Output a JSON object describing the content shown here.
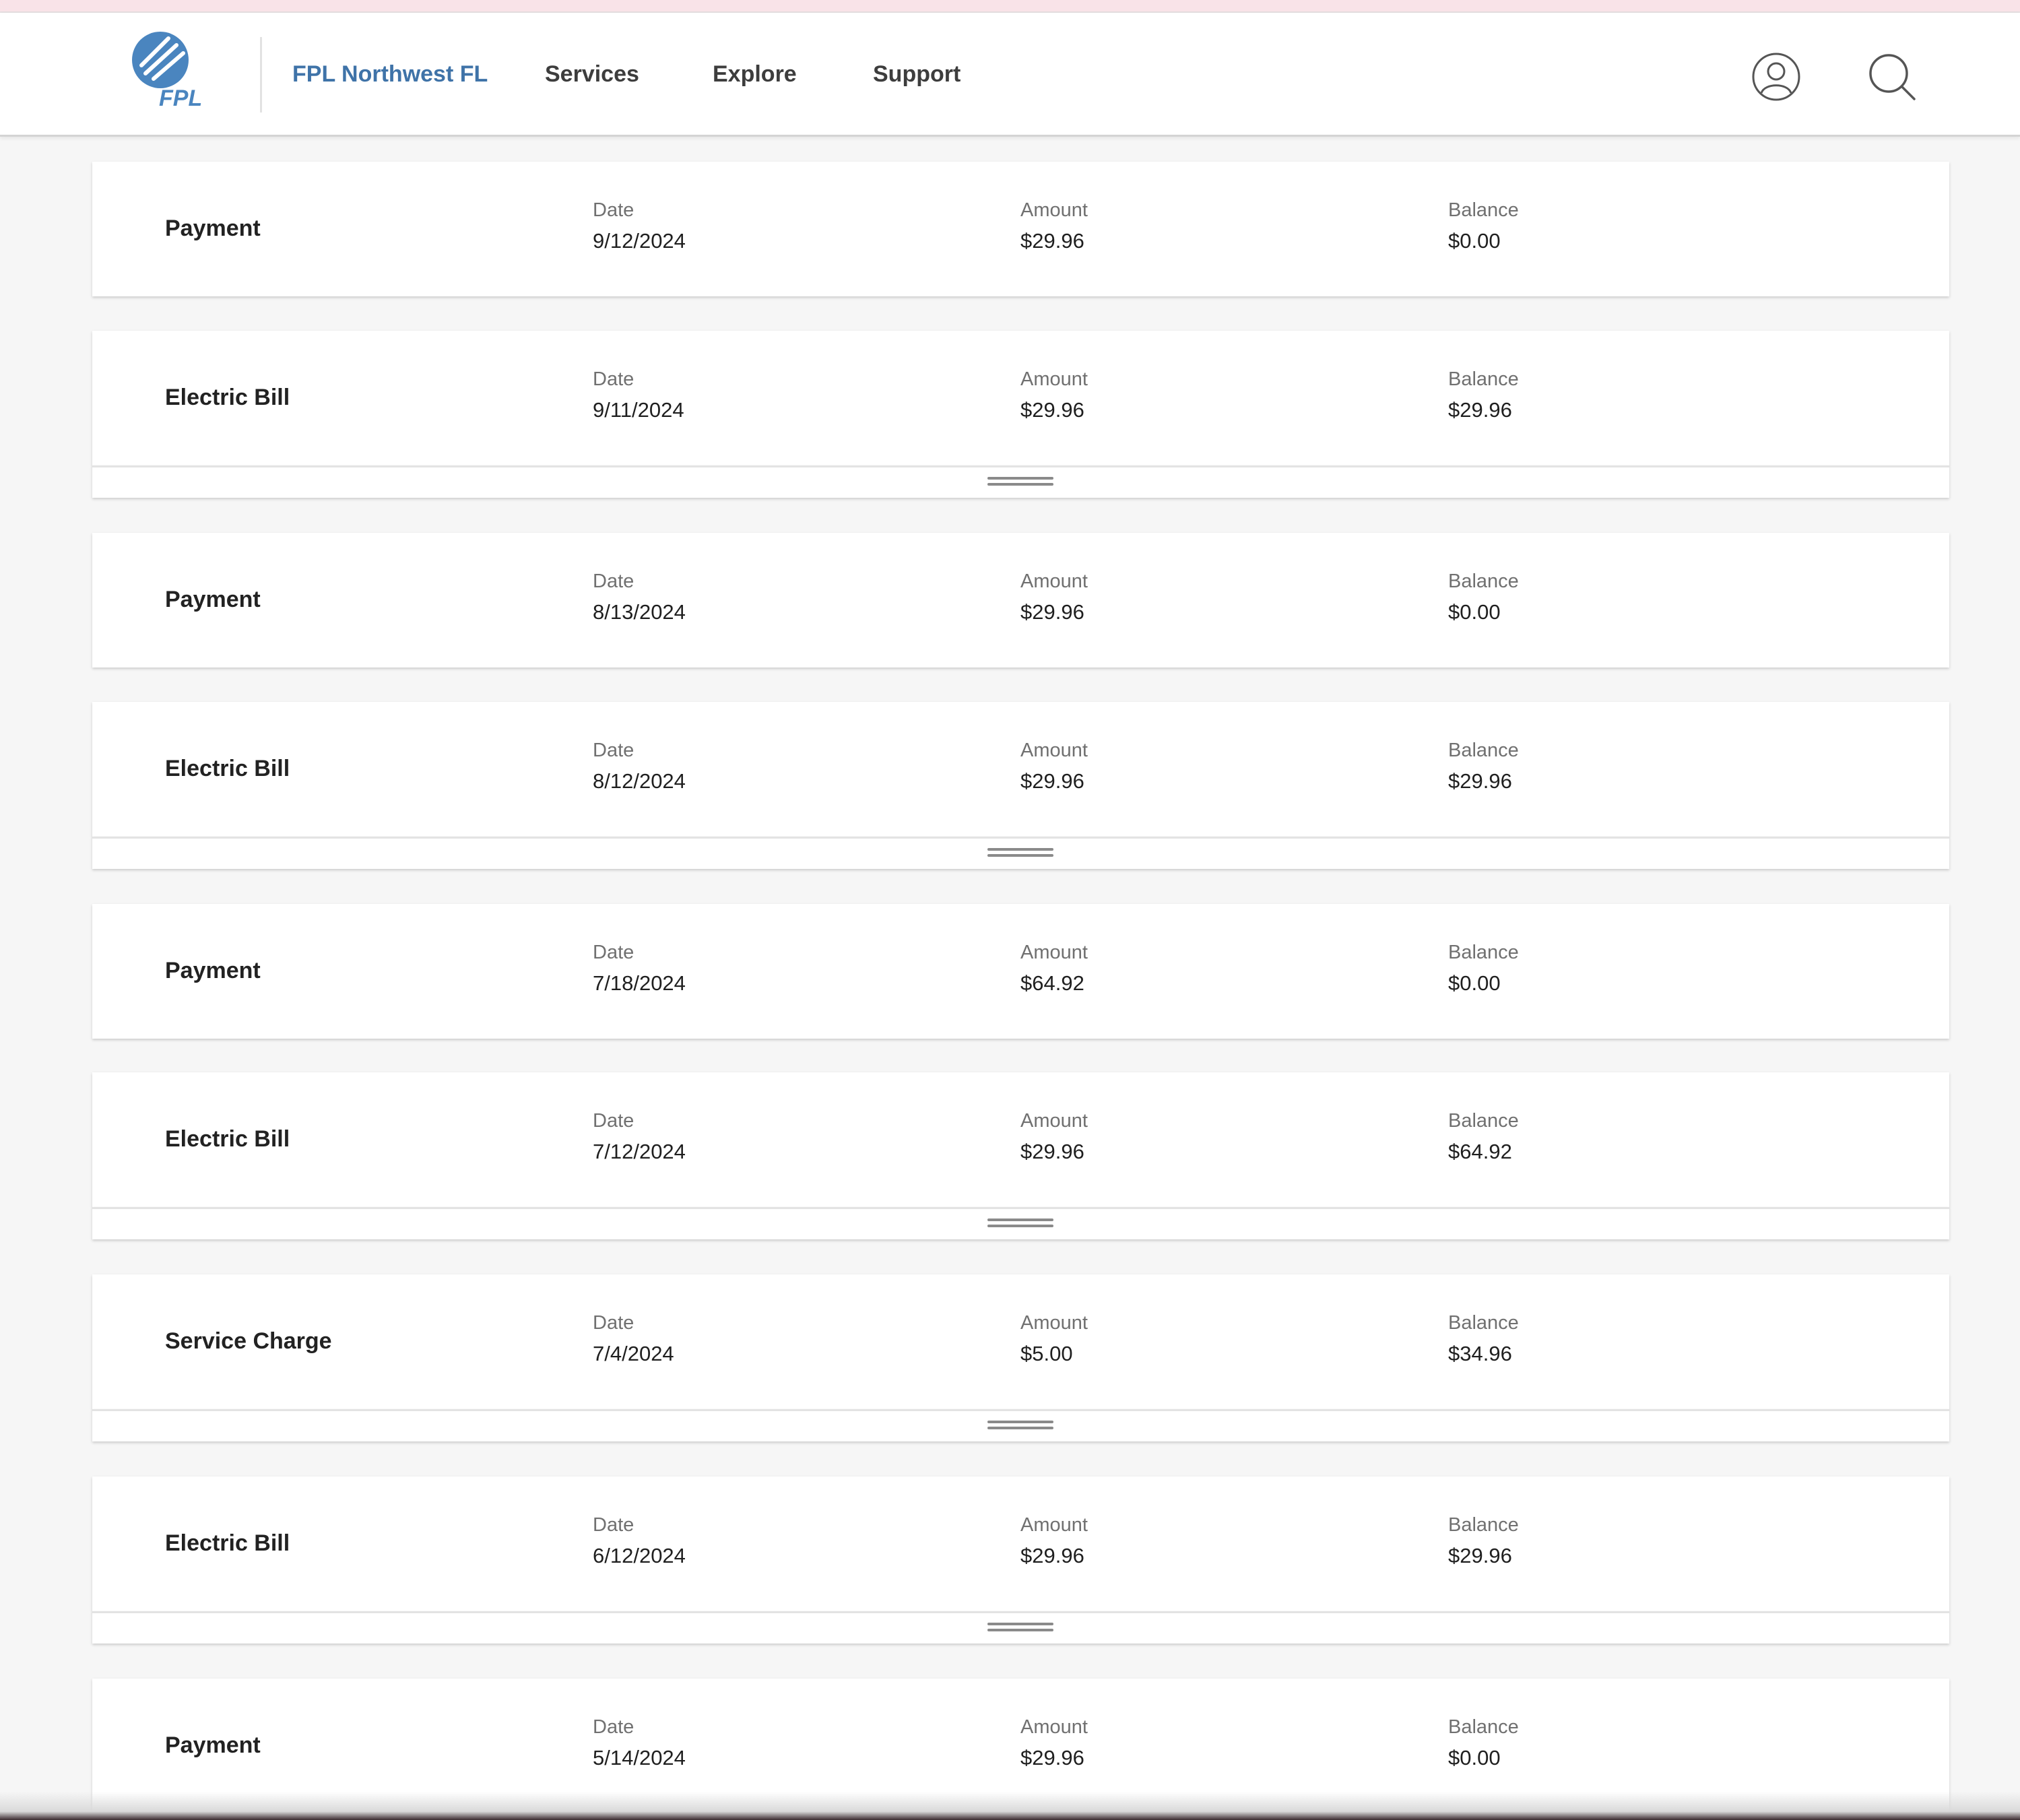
{
  "header": {
    "logo_text": "FPL",
    "brand": "FPL Northwest FL",
    "nav": [
      "Services",
      "Explore",
      "Support"
    ],
    "icons": [
      "account-icon",
      "search-icon"
    ],
    "brand_color": "#3f73a8"
  },
  "labels": {
    "date": "Date",
    "amount": "Amount",
    "balance": "Balance"
  },
  "transactions": [
    {
      "type": "Payment",
      "date": "9/12/2024",
      "amount": "$29.96",
      "balance": "$0.00"
    },
    {
      "type": "Electric Bill",
      "date": "9/11/2024",
      "amount": "$29.96",
      "balance": "$29.96"
    },
    {
      "type": "Payment",
      "date": "8/13/2024",
      "amount": "$29.96",
      "balance": "$0.00"
    },
    {
      "type": "Electric Bill",
      "date": "8/12/2024",
      "amount": "$29.96",
      "balance": "$29.96"
    },
    {
      "type": "Payment",
      "date": "7/18/2024",
      "amount": "$64.92",
      "balance": "$0.00"
    },
    {
      "type": "Electric Bill",
      "date": "7/12/2024",
      "amount": "$29.96",
      "balance": "$64.92"
    },
    {
      "type": "Service Charge",
      "date": "7/4/2024",
      "amount": "$5.00",
      "balance": "$34.96"
    },
    {
      "type": "Electric Bill",
      "date": "6/12/2024",
      "amount": "$29.96",
      "balance": "$29.96"
    },
    {
      "type": "Payment",
      "date": "5/14/2024",
      "amount": "$29.96",
      "balance": "$0.00"
    }
  ]
}
